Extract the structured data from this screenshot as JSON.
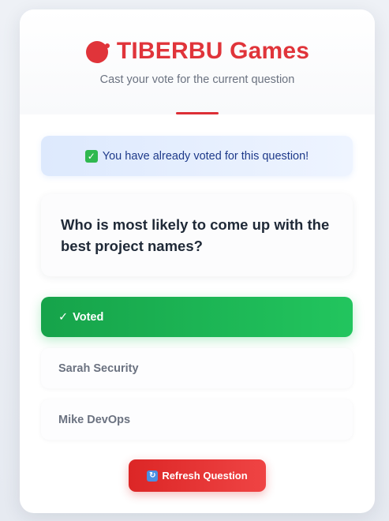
{
  "brand": {
    "title": "TIBERBU Games",
    "logo_icon": "red-circle-logo-icon",
    "accent_color": "#e0343a"
  },
  "subtitle": "Cast your vote for the current question",
  "notice": {
    "icon": "check-mark-button-icon",
    "text": "You have already voted for this question!"
  },
  "question": {
    "text": "Who is most likely to come up with the best project names?"
  },
  "options": [
    {
      "label": "Voted",
      "state": "voted",
      "icon": "check-icon",
      "color": "#22c55e"
    },
    {
      "label": "Sarah Security",
      "state": "default"
    },
    {
      "label": "Mike DevOps",
      "state": "default"
    }
  ],
  "refresh_button": {
    "icon": "refresh-arrows-icon",
    "label": "Refresh Question",
    "color": "#dc2626"
  }
}
